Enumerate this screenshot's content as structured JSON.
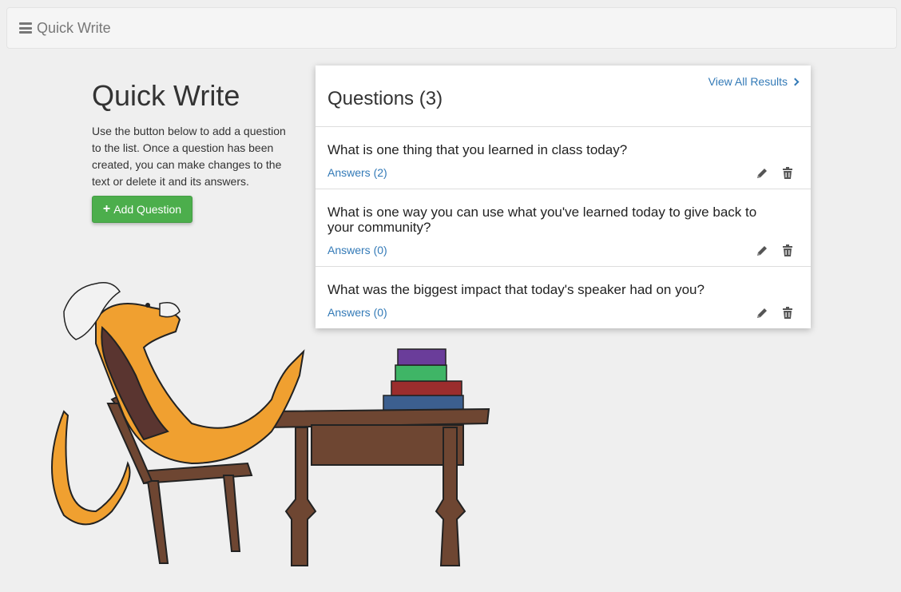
{
  "topbar": {
    "title": "Quick Write"
  },
  "intro": {
    "heading": "Quick Write",
    "description": "Use the button below to add a question to the list. Once a question has been created, you can make changes to the text or delete it and its answers.",
    "add_button": "Add Question"
  },
  "panel": {
    "heading": "Questions (3)",
    "view_all": "View All Results",
    "questions": [
      {
        "text": "What is one thing that you learned in class today?",
        "answers": "Answers (2)"
      },
      {
        "text": "What is one way you can use what you've learned today to give back to your community?",
        "answers": "Answers (0)"
      },
      {
        "text": "What was the biggest impact that today's speaker had on you?",
        "answers": "Answers (0)"
      }
    ]
  },
  "icons": {
    "menu": "bars-icon",
    "add": "plus-icon",
    "view_all": "chevron-right-icon",
    "edit": "pencil-icon",
    "delete": "trash-icon"
  },
  "colors": {
    "link": "#337ab7",
    "button": "#4cae4c",
    "background": "#efefef"
  }
}
